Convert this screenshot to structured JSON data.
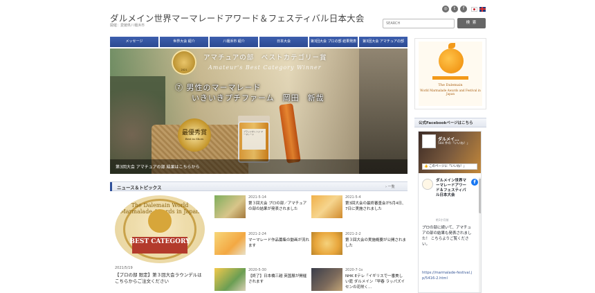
{
  "header": {
    "title": "ダルメイン世界マーマレードアワード＆フェスティバル日本大会",
    "subtitle": "開催：愛媛県八幡浜市",
    "search_placeholder": "SEARCH",
    "search_button": "検 索"
  },
  "nav": {
    "items": [
      {
        "label": "メッセージ"
      },
      {
        "label": "世界大会 紹介"
      },
      {
        "label": "八幡浜市 紹介"
      },
      {
        "label": "日本大会"
      },
      {
        "label": "第3回大会 プロの部 結果発表"
      },
      {
        "label": "第3回大会 アマチュアの部"
      }
    ]
  },
  "hero": {
    "category": "アマチュアの部　ベストカテゴリー賞",
    "category_en": "Amateur's Best Category Winner",
    "winner_line1": "⑦ 男性のマーマレード",
    "winner_line2": "いきいきプチファーム　岡田　新哉",
    "badge_main": "最優秀賞",
    "badge_sub": "Best in Show",
    "badge_year": "2021",
    "jar_label": "ブラッドオレンジ マーマレード",
    "caption": "第3回大会 アマチュアの部 結果はこちらから"
  },
  "news": {
    "heading": "ニュース＆トピックス",
    "more": "一覧",
    "featured": {
      "image_text": "The Dalemain World Marmalade Awards in Japan",
      "image_best": "BEST CATEGORY",
      "date": "2021/5/19",
      "text": "【プロの部 限定】第３回大会ラウンデルはこちらからご注文ください"
    },
    "items": [
      {
        "date": "2021-5-14",
        "text": "第３回大会 プロの部／アマチュアの部の結果が発表されました"
      },
      {
        "date": "2021-5-4",
        "text": "第3回大会の最終審査会が5月4日、7日に実施されました"
      },
      {
        "date": "2021-2-24",
        "text": "マーマレード作品募集の動画が流れます"
      },
      {
        "date": "2021-2-2",
        "text": "第３回大会の実施概要が公開されました"
      },
      {
        "date": "2020-5-30",
        "text": "【終了】日本橋三越 英国展が開催されます"
      },
      {
        "date": "2020-7-1s",
        "text": "NHK Eテレ「イギリスで一番美しい庭 ダルメイン「早春 ラッパズイセンの花咲く..."
      }
    ]
  },
  "sidebar": {
    "logo_name": "The Dalemain",
    "logo_line2": "World Marmalade Awards and Festival in Japan",
    "fb_heading": "公式Facebookページはこちら",
    "fb_page_name": "ダルメイ...",
    "fb_likes": "584 件の「いいね！」",
    "fb_like_button": "このページに「いいね！」",
    "fb_post_name": "ダルメイン世界マーマレードアワード＆フェスティバル日本大会",
    "fb_post_time": "約1か月前",
    "fb_post_body": "プロの部に続いて、アマチュアの部の結果も発表されました！\nこちらよりご覧ください。",
    "fb_post_link": "https://marmalade-festival.jp/5416-2.html"
  }
}
